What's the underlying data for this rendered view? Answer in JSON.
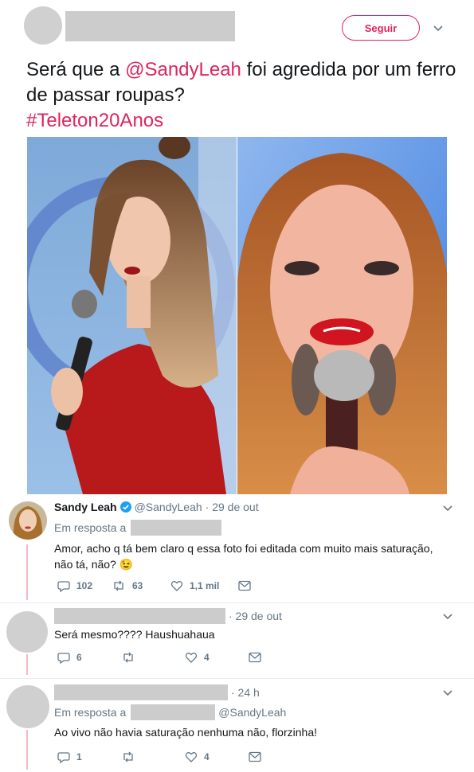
{
  "main_tweet": {
    "follow_label": "Seguir",
    "text_prefix": "Será que a ",
    "mention": "@SandyLeah",
    "text_suffix": " foi agredida por um ferro de passar roupas?",
    "hashtag": "#Teleton20Anos"
  },
  "replies": [
    {
      "name": "Sandy Leah",
      "handle": "@SandyLeah",
      "date": "· 29 de out",
      "replying_prefix": "Em resposta a",
      "text": "Amor, acho q tá bem claro q essa foto foi editada com muito mais saturação, não tá, não? 😉",
      "reply_count": "102",
      "retweet_count": "63",
      "like_count": "1,1 mil"
    },
    {
      "date": "· 29 de out",
      "text": "Será mesmo???? Haushuahaua",
      "reply_count": "6",
      "retweet_count": "",
      "like_count": "4"
    },
    {
      "date": "· 24 h",
      "replying_prefix": "Em resposta a",
      "replying_mention": "@SandyLeah",
      "text": "Ao vivo não havia saturação nenhuma não, florzinha!",
      "reply_count": "1",
      "retweet_count": "",
      "like_count": "4"
    }
  ],
  "colors": {
    "accent": "#e0245e",
    "muted": "#657786",
    "verified": "#1da1f2"
  },
  "icons": [
    "chevron-down-icon",
    "verified-badge-icon",
    "reply-icon",
    "retweet-icon",
    "like-icon",
    "dm-icon"
  ]
}
